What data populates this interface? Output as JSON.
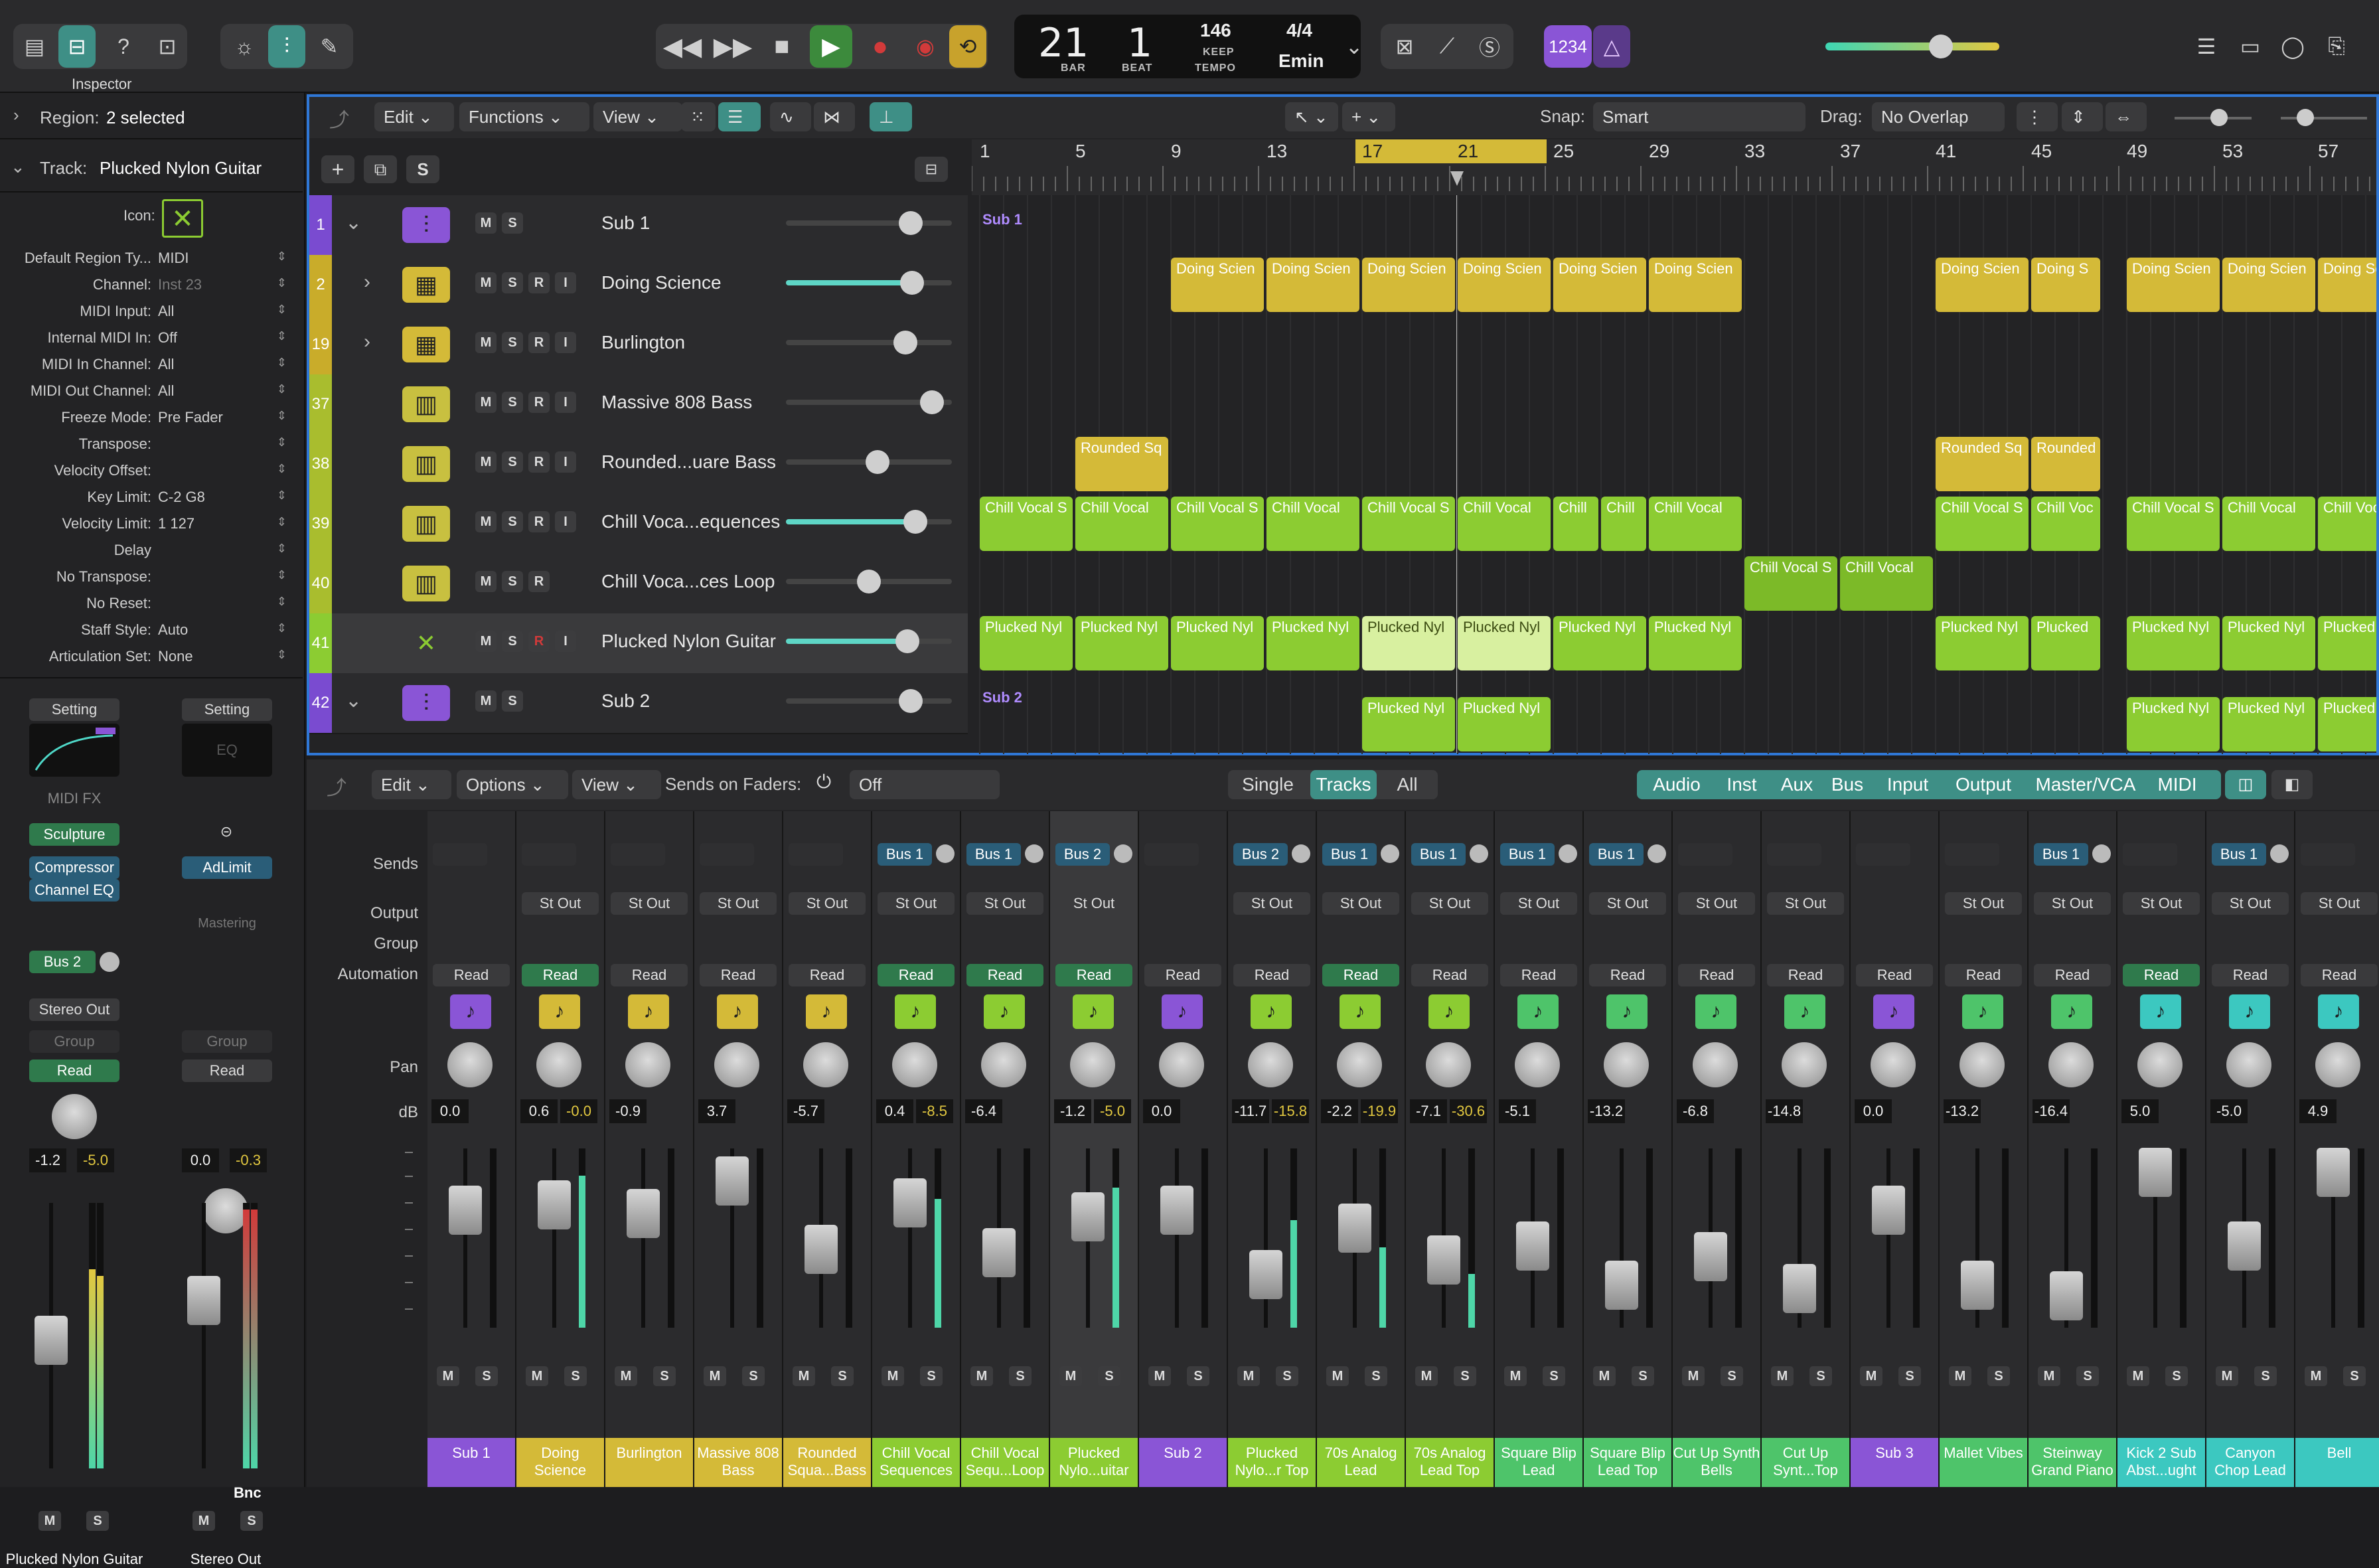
{
  "topbar": {
    "lcd": {
      "bar": "21",
      "beat": "1",
      "bar_label": "BAR",
      "beat_label": "BEAT",
      "tempo": "146",
      "keep": "KEEP",
      "tempo_label": "TEMPO",
      "time_sig": "4/4",
      "key": "Emin"
    },
    "count_in": "1234",
    "tooltip": "Inspector"
  },
  "inspector": {
    "region_label": "Region:",
    "region_value": "2 selected",
    "track_label": "Track:",
    "track_value": "Plucked Nylon Guitar",
    "icon_label": "Icon:",
    "rows": [
      {
        "label": "Default Region Ty...",
        "value": "MIDI"
      },
      {
        "label": "Channel:",
        "value": "Inst 23"
      },
      {
        "label": "MIDI Input:",
        "value": "All"
      },
      {
        "label": "Internal MIDI In:",
        "value": "Off"
      },
      {
        "label": "MIDI In Channel:",
        "value": "All"
      },
      {
        "label": "MIDI Out Channel:",
        "value": "All"
      },
      {
        "label": "Freeze Mode:",
        "value": "Pre Fader"
      },
      {
        "label": "Transpose:",
        "value": ""
      },
      {
        "label": "Velocity Offset:",
        "value": ""
      },
      {
        "label": "Key Limit:",
        "value": "C-2  G8"
      },
      {
        "label": "Velocity Limit:",
        "value": "1  127"
      },
      {
        "label": "Delay",
        "value": ""
      },
      {
        "label": "No Transpose:",
        "value": ""
      },
      {
        "label": "No Reset:",
        "value": ""
      },
      {
        "label": "Staff Style:",
        "value": "Auto"
      },
      {
        "label": "Articulation Set:",
        "value": "None"
      }
    ],
    "strip1": {
      "setting": "Setting",
      "midi_fx": "MIDI FX",
      "plugin1": "Sculpture",
      "plugin2": "Compressor",
      "plugin3": "Channel EQ",
      "send": "Bus 2",
      "output": "Stereo Out",
      "group": "Group",
      "auto": "Read",
      "db1": "-1.2",
      "db2": "-5.0",
      "m": "M",
      "s": "S",
      "name": "Plucked Nylon Guitar"
    },
    "strip2": {
      "setting": "Setting",
      "eq": "EQ",
      "plugin1": "AdLimit",
      "mastering": "Mastering",
      "group": "Group",
      "auto": "Read",
      "db1": "0.0",
      "db2": "-0.3",
      "bnc": "Bnc",
      "m": "M",
      "s": "S",
      "name": "Stereo Out"
    }
  },
  "tracks_toolbar": {
    "edit": "Edit",
    "functions": "Functions",
    "view": "View",
    "snap_label": "Snap:",
    "snap_value": "Smart",
    "drag_label": "Drag:",
    "drag_value": "No Overlap"
  },
  "ruler": [
    "1",
    "5",
    "9",
    "13",
    "17",
    "21",
    "25",
    "29",
    "33",
    "37",
    "41",
    "45",
    "49",
    "53",
    "57"
  ],
  "tracks": [
    {
      "num": "1",
      "name": "Sub 1",
      "type": "sub"
    },
    {
      "num": "2",
      "name": "Doing Science",
      "type": "drum"
    },
    {
      "num": "19",
      "name": "Burlington",
      "type": "drum"
    },
    {
      "num": "37",
      "name": "Massive 808 Bass",
      "type": "inst"
    },
    {
      "num": "38",
      "name": "Rounded...uare Bass",
      "type": "inst"
    },
    {
      "num": "39",
      "name": "Chill Voca...equences",
      "type": "inst"
    },
    {
      "num": "40",
      "name": "Chill Voca...ces Loop",
      "type": "inst"
    },
    {
      "num": "41",
      "name": "Plucked Nylon Guitar",
      "type": "guitar"
    },
    {
      "num": "42",
      "name": "Sub 2",
      "type": "sub"
    }
  ],
  "regions": {
    "sub1": "Sub 1",
    "sub2": "Sub 2",
    "doing": "Doing Scien",
    "doing_short": "Doing S",
    "rounded": "Rounded Sq",
    "rounded_short": "Rounded",
    "chill_s": "Chill Vocal S",
    "chill": "Chill Vocal",
    "chill_short": "Chill Voc",
    "chill_c": "Chill",
    "plucked": "Plucked Nyl",
    "plucked_short": "Plucked"
  },
  "mixer_toolbar": {
    "edit": "Edit",
    "options": "Options",
    "view": "View",
    "sends_label": "Sends on Faders:",
    "sends_value": "Off",
    "single": "Single",
    "tracks": "Tracks",
    "all": "All",
    "filters": [
      "Audio",
      "Inst",
      "Aux",
      "Bus",
      "Input",
      "Output",
      "Master/VCA",
      "MIDI"
    ]
  },
  "mixer_labels": {
    "sends": "Sends",
    "output": "Output",
    "group": "Group",
    "automation": "Automation",
    "pan": "Pan",
    "db": "dB"
  },
  "strips": [
    {
      "name": "Sub 1",
      "send": "",
      "output": "",
      "auto": "Read",
      "auto_on": false,
      "db1": "0.0",
      "db2": "",
      "color": "#8a55d6",
      "fader": 0.72,
      "meter": 0
    },
    {
      "name": "Doing Science",
      "send": "",
      "output": "St Out",
      "auto": "Read",
      "auto_on": true,
      "db1": "0.6",
      "db2": "-0.0",
      "color": "#d4ba38",
      "fader": 0.75,
      "meter": 0.85
    },
    {
      "name": "Burlington",
      "send": "",
      "output": "St Out",
      "auto": "Read",
      "auto_on": false,
      "db1": "-0.9",
      "db2": "",
      "color": "#d4ba38",
      "fader": 0.7,
      "meter": 0
    },
    {
      "name": "Massive 808 Bass",
      "send": "",
      "output": "St Out",
      "auto": "Read",
      "auto_on": false,
      "db1": "3.7",
      "db2": "",
      "color": "#d4ba38",
      "fader": 0.88,
      "meter": 0
    },
    {
      "name": "Rounded Squa...Bass",
      "send": "",
      "output": "St Out",
      "auto": "Read",
      "auto_on": false,
      "db1": "-5.7",
      "db2": "",
      "color": "#d4ba38",
      "fader": 0.5,
      "meter": 0
    },
    {
      "name": "Chill Vocal Sequences",
      "send": "Bus 1",
      "output": "St Out",
      "auto": "Read",
      "auto_on": true,
      "db1": "0.4",
      "db2": "-8.5",
      "color": "#8ccc32",
      "fader": 0.76,
      "meter": 0.72
    },
    {
      "name": "Chill Vocal Sequ...Loop",
      "send": "Bus 1",
      "output": "St Out",
      "auto": "Read",
      "auto_on": true,
      "db1": "-6.4",
      "db2": "",
      "color": "#8ccc32",
      "fader": 0.48,
      "meter": 0
    },
    {
      "name": "Plucked Nylo...uitar",
      "send": "Bus 2",
      "output": "St Out",
      "auto": "Read",
      "auto_on": true,
      "db1": "-1.2",
      "db2": "-5.0",
      "color": "#8ccc32",
      "fader": 0.68,
      "meter": 0.78
    },
    {
      "name": "Sub 2",
      "send": "",
      "output": "",
      "auto": "Read",
      "auto_on": false,
      "db1": "0.0",
      "db2": "",
      "color": "#8a55d6",
      "fader": 0.72,
      "meter": 0
    },
    {
      "name": "Plucked Nylo...r Top",
      "send": "Bus 2",
      "output": "St Out",
      "auto": "Read",
      "auto_on": false,
      "db1": "-11.7",
      "db2": "-15.8",
      "color": "#8ccc32",
      "fader": 0.36,
      "meter": 0.6
    },
    {
      "name": "70s Analog Lead",
      "send": "Bus 1",
      "output": "St Out",
      "auto": "Read",
      "auto_on": true,
      "db1": "-2.2",
      "db2": "-19.9",
      "color": "#8ccc32",
      "fader": 0.62,
      "meter": 0.45
    },
    {
      "name": "70s Analog Lead Top",
      "send": "Bus 1",
      "output": "St Out",
      "auto": "Read",
      "auto_on": false,
      "db1": "-7.1",
      "db2": "-30.6",
      "color": "#8ccc32",
      "fader": 0.44,
      "meter": 0.3
    },
    {
      "name": "Square Blip Lead",
      "send": "Bus 1",
      "output": "St Out",
      "auto": "Read",
      "auto_on": false,
      "db1": "-5.1",
      "db2": "",
      "color": "#4ec46a",
      "fader": 0.52,
      "meter": 0
    },
    {
      "name": "Square Blip Lead Top",
      "send": "Bus 1",
      "output": "St Out",
      "auto": "Read",
      "auto_on": false,
      "db1": "-13.2",
      "db2": "",
      "color": "#4ec46a",
      "fader": 0.3,
      "meter": 0
    },
    {
      "name": "Cut Up Synth Bells",
      "send": "",
      "output": "St Out",
      "auto": "Read",
      "auto_on": false,
      "db1": "-6.8",
      "db2": "",
      "color": "#4ec46a",
      "fader": 0.46,
      "meter": 0
    },
    {
      "name": "Cut Up Synt...Top",
      "send": "",
      "output": "St Out",
      "auto": "Read",
      "auto_on": false,
      "db1": "-14.8",
      "db2": "",
      "color": "#4ec46a",
      "fader": 0.28,
      "meter": 0
    },
    {
      "name": "Sub 3",
      "send": "",
      "output": "",
      "auto": "Read",
      "auto_on": false,
      "db1": "0.0",
      "db2": "",
      "color": "#8a55d6",
      "fader": 0.72,
      "meter": 0
    },
    {
      "name": "Mallet Vibes",
      "send": "",
      "output": "St Out",
      "auto": "Read",
      "auto_on": false,
      "db1": "-13.2",
      "db2": "",
      "color": "#4ec46a",
      "fader": 0.3,
      "meter": 0
    },
    {
      "name": "Steinway Grand Piano",
      "send": "Bus 1",
      "output": "St Out",
      "auto": "Read",
      "auto_on": false,
      "db1": "-16.4",
      "db2": "",
      "color": "#4ec46a",
      "fader": 0.24,
      "meter": 0
    },
    {
      "name": "Kick 2 Sub Abst...ught",
      "send": "",
      "output": "St Out",
      "auto": "Read",
      "auto_on": true,
      "db1": "5.0",
      "db2": "",
      "color": "#3cc8c0",
      "fader": 0.93,
      "meter": 0
    },
    {
      "name": "Canyon Chop Lead",
      "send": "Bus 1",
      "output": "St Out",
      "auto": "Read",
      "auto_on": false,
      "db1": "-5.0",
      "db2": "",
      "color": "#3cc8c0",
      "fader": 0.52,
      "meter": 0
    },
    {
      "name": "Bell",
      "send": "",
      "output": "St Out",
      "auto": "Read",
      "auto_on": false,
      "db1": "4.9",
      "db2": "",
      "color": "#3cc8c0",
      "fader": 0.93,
      "meter": 0
    }
  ],
  "ms": {
    "m": "M",
    "s": "S",
    "r": "R",
    "i": "I"
  }
}
